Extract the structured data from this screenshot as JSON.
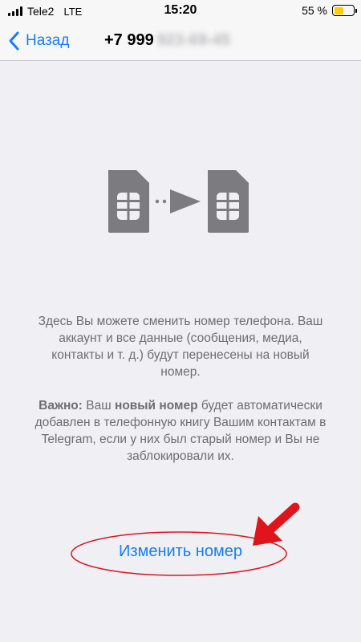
{
  "status_bar": {
    "carrier": "Tele2",
    "network": "LTE",
    "time": "15:20",
    "battery_percent_text": "55 %",
    "battery_level": 0.55,
    "battery_color": "#ffcc00"
  },
  "nav": {
    "back_label": "Назад",
    "title_visible": "+7 999",
    "title_obscured": "923-69-45"
  },
  "content": {
    "description": "Здесь Вы можете сменить номер телефона. Ваш аккаунт и все данные (сообщения, медиа, контакты и т. д.) будут перенесены на новый номер.",
    "important_label": "Важно:",
    "important_text_1": " Ваш ",
    "important_bold": "новый номер",
    "important_text_2": " будет автоматически добавлен в телефонную книгу Вашим контактам в Telegram, если у них был старый номер и Вы не заблокировали их.",
    "change_button": "Изменить номер"
  },
  "colors": {
    "accent": "#157efb",
    "icon_gray": "#7b7b80",
    "annotation_red": "#e0141b"
  },
  "icons": [
    "back-chevron-icon",
    "sim-card-icon",
    "arrow-right-icon",
    "battery-icon",
    "signal-icon"
  ]
}
